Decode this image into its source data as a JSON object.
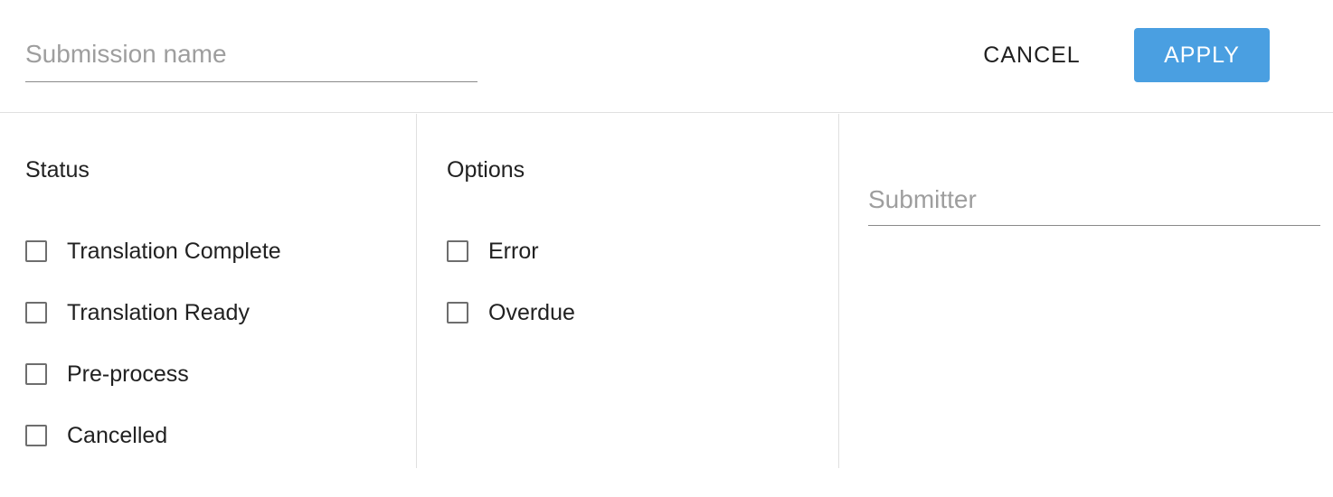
{
  "header": {
    "name_placeholder": "Submission name",
    "cancel_label": "CANCEL",
    "apply_label": "APPLY"
  },
  "status": {
    "title": "Status",
    "items": [
      {
        "label": "Translation Complete"
      },
      {
        "label": "Translation Ready"
      },
      {
        "label": "Pre-process"
      },
      {
        "label": "Cancelled"
      }
    ]
  },
  "options": {
    "title": "Options",
    "items": [
      {
        "label": "Error"
      },
      {
        "label": "Overdue"
      }
    ]
  },
  "submitter": {
    "placeholder": "Submitter"
  },
  "colors": {
    "accent": "#4a9fe1",
    "divider": "#e0e0e0"
  }
}
